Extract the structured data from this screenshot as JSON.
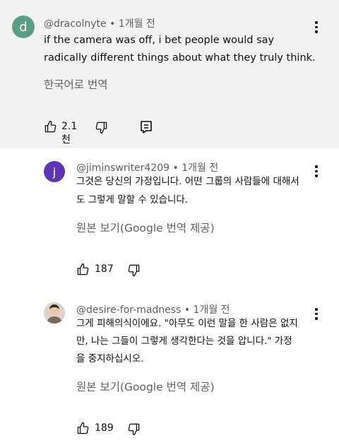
{
  "comments": [
    {
      "avatar_letter": "d",
      "avatar_color": "#5a9e83",
      "handle_line": "@dracolnyte • 1개월 전",
      "text_lines": [
        "if the camera was off, i bet people would say",
        "radically different things about what they truly think."
      ],
      "translate_label": "한국어로 번역",
      "like_count": "2.1천"
    },
    {
      "avatar_letter": "j",
      "avatar_color": "#5e35b1",
      "handle_line": "@jiminswriter4209 • 1개월 전",
      "text_lines": [
        "그것은 당신의 가정입니다. 어떤 그룹의 사람들에 대해서",
        "도 그렇게 말할 수 있습니다."
      ],
      "translate_label": "원본 보기(Google 번역 제공)",
      "like_count": "187"
    },
    {
      "avatar_color": "#d9cbbd",
      "handle_line": "@desire-for-madness • 1개월 전",
      "text_lines": [
        "그게 피해의식이에요. \"아무도 이런 말을 한 사람은 없지",
        "만, 나는 그들이 그렇게 생각한다는 것을 압니다.\" 가정",
        "을 중지하십시오."
      ],
      "translate_label": "원본 보기(Google 번역 제공)",
      "like_count": "189"
    }
  ]
}
